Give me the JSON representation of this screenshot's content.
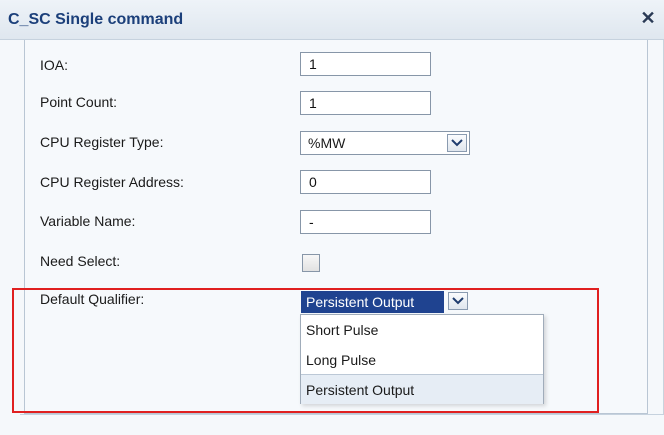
{
  "dialog": {
    "title": "C_SC Single command",
    "close_glyph": "✕"
  },
  "fields": {
    "ioa": {
      "label": "IOA:",
      "value": "1"
    },
    "point_count": {
      "label": "Point Count:",
      "value": "1"
    },
    "cpu_register_type": {
      "label": "CPU Register Type:",
      "value": "%MW"
    },
    "cpu_register_address": {
      "label": "CPU Register Address:",
      "value": "0"
    },
    "variable_name": {
      "label": "Variable Name:",
      "value": "-"
    },
    "need_select": {
      "label": "Need Select:",
      "checked": false
    },
    "default_qualifier": {
      "label": "Default Qualifier:",
      "value": "Persistent Output",
      "options": [
        "Short Pulse",
        "Long Pulse",
        "Persistent Output"
      ]
    }
  },
  "colors": {
    "title_text": "#1b3f7a",
    "selection_bg": "#1f4390",
    "highlight_border": "#e02020"
  },
  "icons": {
    "close": "close-icon",
    "dropdown": "chevron-down-icon"
  }
}
